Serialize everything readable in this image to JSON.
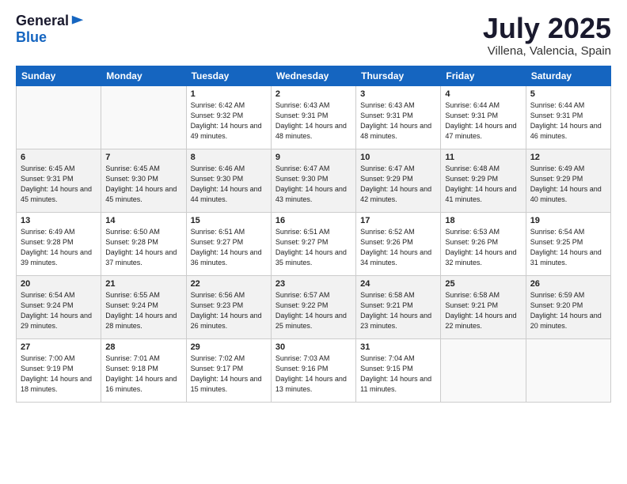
{
  "logo": {
    "general": "General",
    "blue": "Blue"
  },
  "title": "July 2025",
  "subtitle": "Villena, Valencia, Spain",
  "days_of_week": [
    "Sunday",
    "Monday",
    "Tuesday",
    "Wednesday",
    "Thursday",
    "Friday",
    "Saturday"
  ],
  "weeks": [
    [
      {
        "day": "",
        "sunrise": "",
        "sunset": "",
        "daylight": ""
      },
      {
        "day": "",
        "sunrise": "",
        "sunset": "",
        "daylight": ""
      },
      {
        "day": "1",
        "sunrise": "Sunrise: 6:42 AM",
        "sunset": "Sunset: 9:32 PM",
        "daylight": "Daylight: 14 hours and 49 minutes."
      },
      {
        "day": "2",
        "sunrise": "Sunrise: 6:43 AM",
        "sunset": "Sunset: 9:31 PM",
        "daylight": "Daylight: 14 hours and 48 minutes."
      },
      {
        "day": "3",
        "sunrise": "Sunrise: 6:43 AM",
        "sunset": "Sunset: 9:31 PM",
        "daylight": "Daylight: 14 hours and 48 minutes."
      },
      {
        "day": "4",
        "sunrise": "Sunrise: 6:44 AM",
        "sunset": "Sunset: 9:31 PM",
        "daylight": "Daylight: 14 hours and 47 minutes."
      },
      {
        "day": "5",
        "sunrise": "Sunrise: 6:44 AM",
        "sunset": "Sunset: 9:31 PM",
        "daylight": "Daylight: 14 hours and 46 minutes."
      }
    ],
    [
      {
        "day": "6",
        "sunrise": "Sunrise: 6:45 AM",
        "sunset": "Sunset: 9:31 PM",
        "daylight": "Daylight: 14 hours and 45 minutes."
      },
      {
        "day": "7",
        "sunrise": "Sunrise: 6:45 AM",
        "sunset": "Sunset: 9:30 PM",
        "daylight": "Daylight: 14 hours and 45 minutes."
      },
      {
        "day": "8",
        "sunrise": "Sunrise: 6:46 AM",
        "sunset": "Sunset: 9:30 PM",
        "daylight": "Daylight: 14 hours and 44 minutes."
      },
      {
        "day": "9",
        "sunrise": "Sunrise: 6:47 AM",
        "sunset": "Sunset: 9:30 PM",
        "daylight": "Daylight: 14 hours and 43 minutes."
      },
      {
        "day": "10",
        "sunrise": "Sunrise: 6:47 AM",
        "sunset": "Sunset: 9:29 PM",
        "daylight": "Daylight: 14 hours and 42 minutes."
      },
      {
        "day": "11",
        "sunrise": "Sunrise: 6:48 AM",
        "sunset": "Sunset: 9:29 PM",
        "daylight": "Daylight: 14 hours and 41 minutes."
      },
      {
        "day": "12",
        "sunrise": "Sunrise: 6:49 AM",
        "sunset": "Sunset: 9:29 PM",
        "daylight": "Daylight: 14 hours and 40 minutes."
      }
    ],
    [
      {
        "day": "13",
        "sunrise": "Sunrise: 6:49 AM",
        "sunset": "Sunset: 9:28 PM",
        "daylight": "Daylight: 14 hours and 39 minutes."
      },
      {
        "day": "14",
        "sunrise": "Sunrise: 6:50 AM",
        "sunset": "Sunset: 9:28 PM",
        "daylight": "Daylight: 14 hours and 37 minutes."
      },
      {
        "day": "15",
        "sunrise": "Sunrise: 6:51 AM",
        "sunset": "Sunset: 9:27 PM",
        "daylight": "Daylight: 14 hours and 36 minutes."
      },
      {
        "day": "16",
        "sunrise": "Sunrise: 6:51 AM",
        "sunset": "Sunset: 9:27 PM",
        "daylight": "Daylight: 14 hours and 35 minutes."
      },
      {
        "day": "17",
        "sunrise": "Sunrise: 6:52 AM",
        "sunset": "Sunset: 9:26 PM",
        "daylight": "Daylight: 14 hours and 34 minutes."
      },
      {
        "day": "18",
        "sunrise": "Sunrise: 6:53 AM",
        "sunset": "Sunset: 9:26 PM",
        "daylight": "Daylight: 14 hours and 32 minutes."
      },
      {
        "day": "19",
        "sunrise": "Sunrise: 6:54 AM",
        "sunset": "Sunset: 9:25 PM",
        "daylight": "Daylight: 14 hours and 31 minutes."
      }
    ],
    [
      {
        "day": "20",
        "sunrise": "Sunrise: 6:54 AM",
        "sunset": "Sunset: 9:24 PM",
        "daylight": "Daylight: 14 hours and 29 minutes."
      },
      {
        "day": "21",
        "sunrise": "Sunrise: 6:55 AM",
        "sunset": "Sunset: 9:24 PM",
        "daylight": "Daylight: 14 hours and 28 minutes."
      },
      {
        "day": "22",
        "sunrise": "Sunrise: 6:56 AM",
        "sunset": "Sunset: 9:23 PM",
        "daylight": "Daylight: 14 hours and 26 minutes."
      },
      {
        "day": "23",
        "sunrise": "Sunrise: 6:57 AM",
        "sunset": "Sunset: 9:22 PM",
        "daylight": "Daylight: 14 hours and 25 minutes."
      },
      {
        "day": "24",
        "sunrise": "Sunrise: 6:58 AM",
        "sunset": "Sunset: 9:21 PM",
        "daylight": "Daylight: 14 hours and 23 minutes."
      },
      {
        "day": "25",
        "sunrise": "Sunrise: 6:58 AM",
        "sunset": "Sunset: 9:21 PM",
        "daylight": "Daylight: 14 hours and 22 minutes."
      },
      {
        "day": "26",
        "sunrise": "Sunrise: 6:59 AM",
        "sunset": "Sunset: 9:20 PM",
        "daylight": "Daylight: 14 hours and 20 minutes."
      }
    ],
    [
      {
        "day": "27",
        "sunrise": "Sunrise: 7:00 AM",
        "sunset": "Sunset: 9:19 PM",
        "daylight": "Daylight: 14 hours and 18 minutes."
      },
      {
        "day": "28",
        "sunrise": "Sunrise: 7:01 AM",
        "sunset": "Sunset: 9:18 PM",
        "daylight": "Daylight: 14 hours and 16 minutes."
      },
      {
        "day": "29",
        "sunrise": "Sunrise: 7:02 AM",
        "sunset": "Sunset: 9:17 PM",
        "daylight": "Daylight: 14 hours and 15 minutes."
      },
      {
        "day": "30",
        "sunrise": "Sunrise: 7:03 AM",
        "sunset": "Sunset: 9:16 PM",
        "daylight": "Daylight: 14 hours and 13 minutes."
      },
      {
        "day": "31",
        "sunrise": "Sunrise: 7:04 AM",
        "sunset": "Sunset: 9:15 PM",
        "daylight": "Daylight: 14 hours and 11 minutes."
      },
      {
        "day": "",
        "sunrise": "",
        "sunset": "",
        "daylight": ""
      },
      {
        "day": "",
        "sunrise": "",
        "sunset": "",
        "daylight": ""
      }
    ]
  ]
}
